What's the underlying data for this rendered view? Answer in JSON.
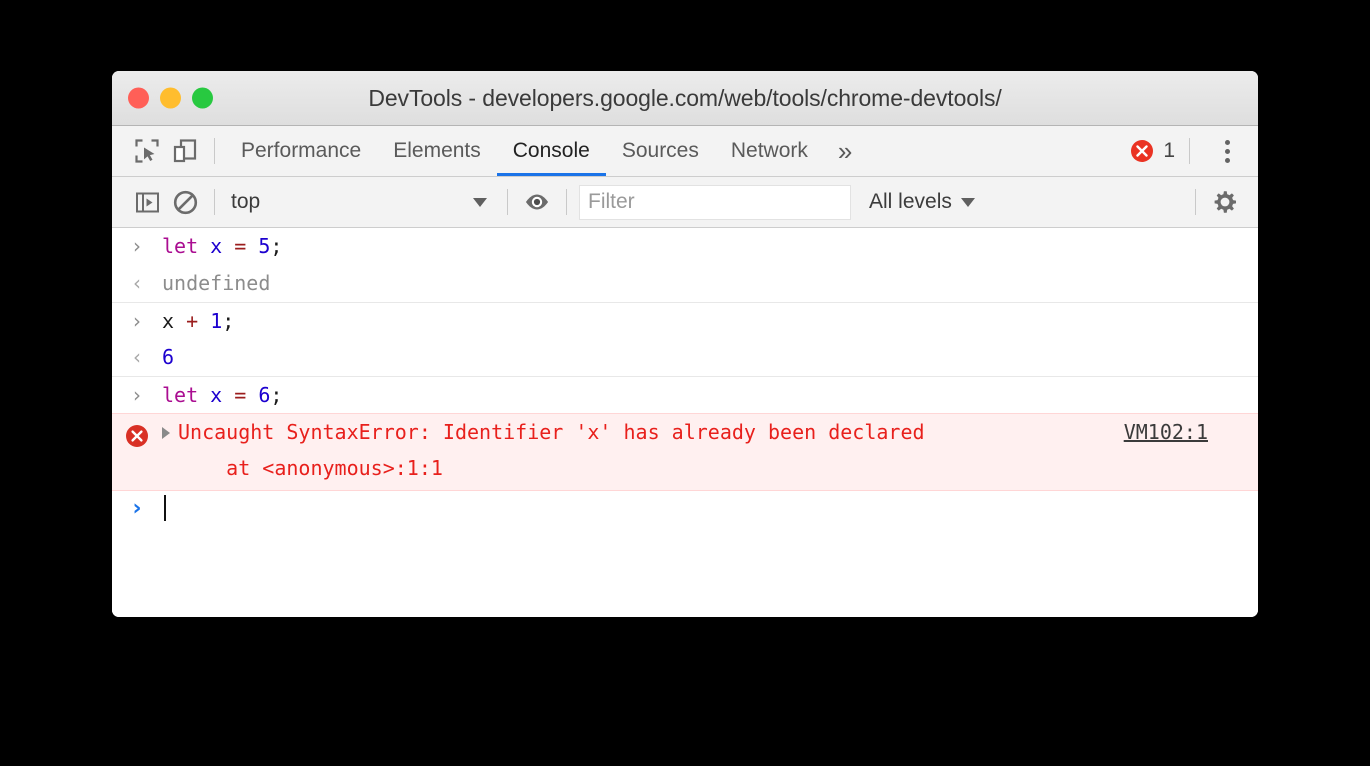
{
  "window": {
    "title": "DevTools - developers.google.com/web/tools/chrome-devtools/",
    "traffic_lights": {
      "close_color": "#ff5f57",
      "minimize_color": "#ffbd2e",
      "maximize_color": "#28c940"
    }
  },
  "tabbar": {
    "inspect_icon": "inspect-element-icon",
    "device_icon": "device-toolbar-icon",
    "tabs": [
      {
        "label": "Performance",
        "active": false
      },
      {
        "label": "Elements",
        "active": false
      },
      {
        "label": "Console",
        "active": true
      },
      {
        "label": "Sources",
        "active": false
      },
      {
        "label": "Network",
        "active": false
      }
    ],
    "more_tabs": "»",
    "error_count": "1",
    "error_icon": "error-circle-icon",
    "menu_icon": "kebab-menu-icon",
    "active_underline_color": "#1a73e8",
    "error_badge_color": "#ea3323"
  },
  "console_toolbar": {
    "sidebar_icon": "show-console-sidebar-icon",
    "clear_icon": "clear-console-icon",
    "context": "top",
    "context_caret": "chevron-down-icon",
    "eye_icon": "live-expression-eye-icon",
    "filter_placeholder": "Filter",
    "filter_value": "",
    "levels_label": "All levels",
    "levels_caret": "chevron-down-icon",
    "settings_icon": "gear-icon"
  },
  "console": {
    "messages": [
      {
        "kind": "input",
        "gutter": "›",
        "tokens": [
          {
            "t": "let",
            "c": "tok-kw"
          },
          {
            "t": " ",
            "c": "tok-plain"
          },
          {
            "t": "x",
            "c": "tok-var"
          },
          {
            "t": " ",
            "c": "tok-plain"
          },
          {
            "t": "=",
            "c": "tok-op"
          },
          {
            "t": " ",
            "c": "tok-plain"
          },
          {
            "t": "5",
            "c": "tok-num"
          },
          {
            "t": ";",
            "c": "tok-punc"
          }
        ],
        "text": "let x = 5;"
      },
      {
        "kind": "output",
        "gutter": "‹",
        "text": "undefined",
        "value_class": "val-undef"
      },
      {
        "kind": "input",
        "gutter": "›",
        "tokens": [
          {
            "t": "x",
            "c": "tok-plain"
          },
          {
            "t": " ",
            "c": "tok-plain"
          },
          {
            "t": "+",
            "c": "tok-op"
          },
          {
            "t": " ",
            "c": "tok-plain"
          },
          {
            "t": "1",
            "c": "tok-num"
          },
          {
            "t": ";",
            "c": "tok-punc"
          }
        ],
        "text": "x + 1;"
      },
      {
        "kind": "output",
        "gutter": "‹",
        "text": "6",
        "value_class": "val-num"
      },
      {
        "kind": "input",
        "gutter": "›",
        "tokens": [
          {
            "t": "let",
            "c": "tok-kw"
          },
          {
            "t": " ",
            "c": "tok-plain"
          },
          {
            "t": "x",
            "c": "tok-var"
          },
          {
            "t": " ",
            "c": "tok-plain"
          },
          {
            "t": "=",
            "c": "tok-op"
          },
          {
            "t": " ",
            "c": "tok-plain"
          },
          {
            "t": "6",
            "c": "tok-num"
          },
          {
            "t": ";",
            "c": "tok-punc"
          }
        ],
        "text": "let x = 6;"
      }
    ],
    "error": {
      "icon": "error-circle-icon",
      "expander": "disclosure-triangle-icon",
      "line1": "Uncaught SyntaxError: Identifier 'x' has already been declared",
      "line2": "    at <anonymous>:1:1",
      "source_link": "VM102:1",
      "text_color": "#e8201c",
      "background": "#fff0f0"
    },
    "prompt": {
      "chevron": "›",
      "value": "",
      "caret_visible": true
    }
  }
}
